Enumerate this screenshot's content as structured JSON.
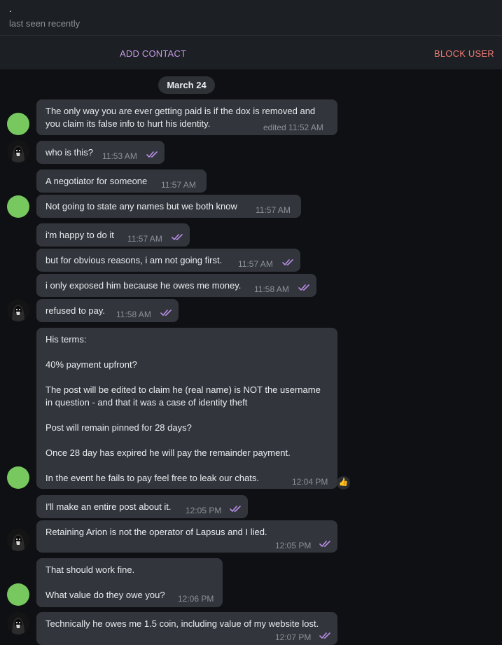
{
  "header": {
    "name": ".",
    "status": "last seen recently"
  },
  "actions": {
    "add_contact": "ADD CONTACT",
    "block_user": "BLOCK USER"
  },
  "date_label": "March 24",
  "messages": [
    {
      "line1": "The only way you are ever getting paid is if the dox is removed and",
      "line2": "you claim its false info to hurt his identity.",
      "time": "edited 11:52 AM"
    },
    {
      "text": "who is this?",
      "time": "11:53 AM"
    },
    {
      "text": "A negotiator for someone",
      "time": "11:57 AM"
    },
    {
      "text": "Not going to state any names but we both know",
      "time": "11:57 AM"
    },
    {
      "text": "i'm happy to do it",
      "time": "11:57 AM"
    },
    {
      "text": "but for obvious reasons, i am not going first.",
      "time": "11:57 AM"
    },
    {
      "text": "i only exposed him because he owes me money.",
      "time": "11:58 AM"
    },
    {
      "text": "refused to pay.",
      "time": "11:58 AM"
    },
    {
      "l1": "His terms:",
      "l2": "40% payment upfront?",
      "l3": "The post will be edited to claim he (real name) is NOT the username",
      "l4": "in question - and that it was a case of identity theft",
      "l5": "Post will remain pinned for 28 days?",
      "l6": "Once 28 day has expired he will pay the remainder payment.",
      "l7": "In the event he fails to pay feel free to leak our chats.",
      "time": "12:04 PM",
      "reaction": "👍"
    },
    {
      "text": "I'll make an entire post about it.",
      "time": "12:05 PM"
    },
    {
      "text": "Retaining Arion is not the operator of Lapsus and I lied.",
      "time": "12:05 PM"
    },
    {
      "l1": "That should work fine.",
      "l2": "What value do they owe you?",
      "time": "12:06 PM"
    },
    {
      "text": "Technically he owes me 1.5 coin, including value of my website lost.",
      "time": "12:07 PM"
    }
  ],
  "colors": {
    "background": "#0e1013",
    "header": "#1c1f23",
    "bubble": "#32353b",
    "accent_add": "#c59be8",
    "accent_block": "#f07a72",
    "read_check": "#b78ee6",
    "avatar_green": "#77c85e"
  },
  "icons": {
    "read_receipt": "double-check-icon",
    "user_avatar": "hooded-figure-avatar"
  }
}
